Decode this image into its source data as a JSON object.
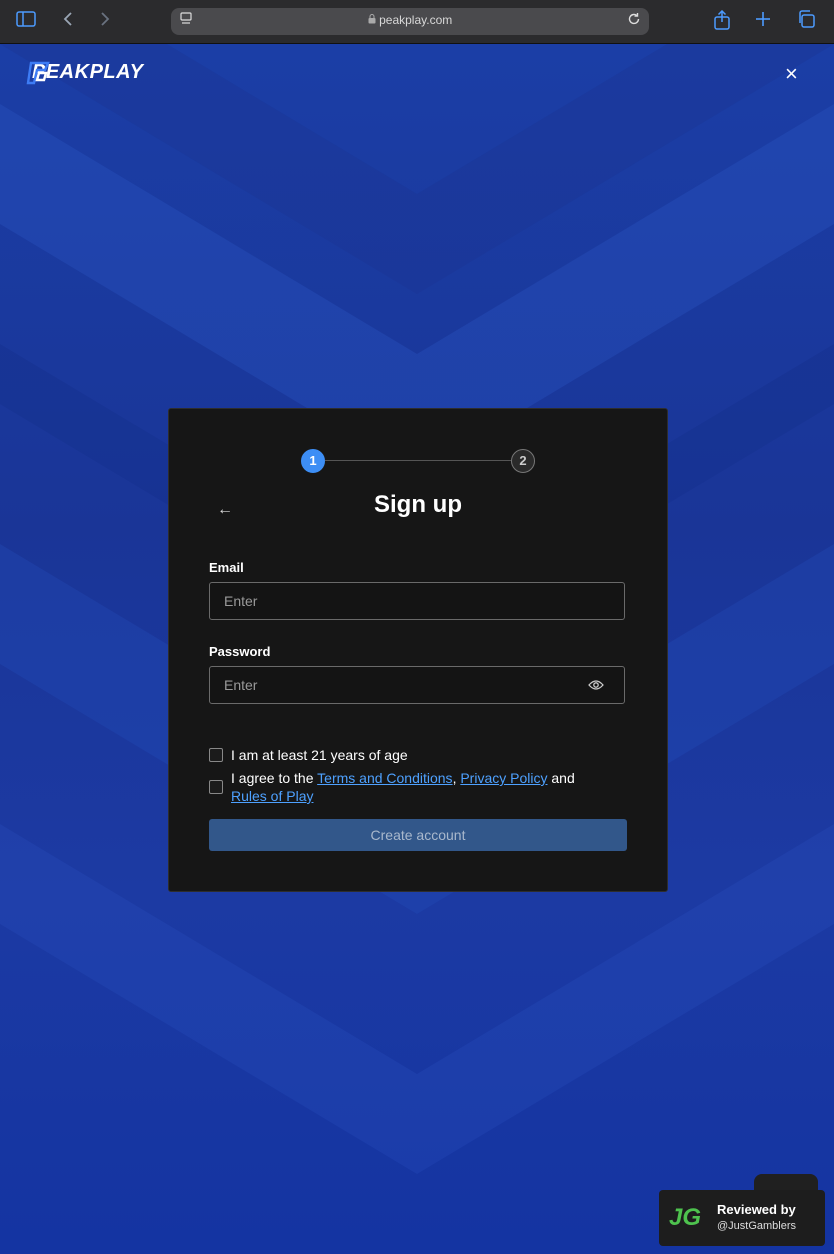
{
  "browser": {
    "url": "peakplay.com",
    "icons": {
      "sidebar": "sidebar-icon",
      "back": "chevron-left-icon",
      "forward": "chevron-right-icon",
      "share": "share-icon",
      "new_tab": "plus-icon",
      "tabs": "tabs-icon",
      "reload": "reload-icon",
      "lock": "lock-icon"
    }
  },
  "header": {
    "logo_text": "PEAKPLAY",
    "close_label": "×"
  },
  "stepper": {
    "steps": [
      "1",
      "2"
    ],
    "active_step": 1
  },
  "form": {
    "title": "Sign up",
    "back_label": "←",
    "email": {
      "label": "Email",
      "placeholder": "Enter"
    },
    "password": {
      "label": "Password",
      "placeholder": "Enter"
    },
    "age_check_label": "I am at least 21 years of age",
    "agree": {
      "prefix": "I agree to the",
      "terms": "Terms and Conditions",
      "comma": ",",
      "privacy": "Privacy Policy",
      "and": "and",
      "rules": "Rules of Play"
    },
    "submit_label": "Create account"
  },
  "review_badge": {
    "logo": "JG",
    "line1": "Reviewed by",
    "line2": "@JustGamblers"
  },
  "colors": {
    "accent": "#3d8ef5",
    "link": "#4ea1ff",
    "card_bg": "#161616",
    "button_disabled": "#32578a",
    "background_blue": "#1b3ea6"
  }
}
